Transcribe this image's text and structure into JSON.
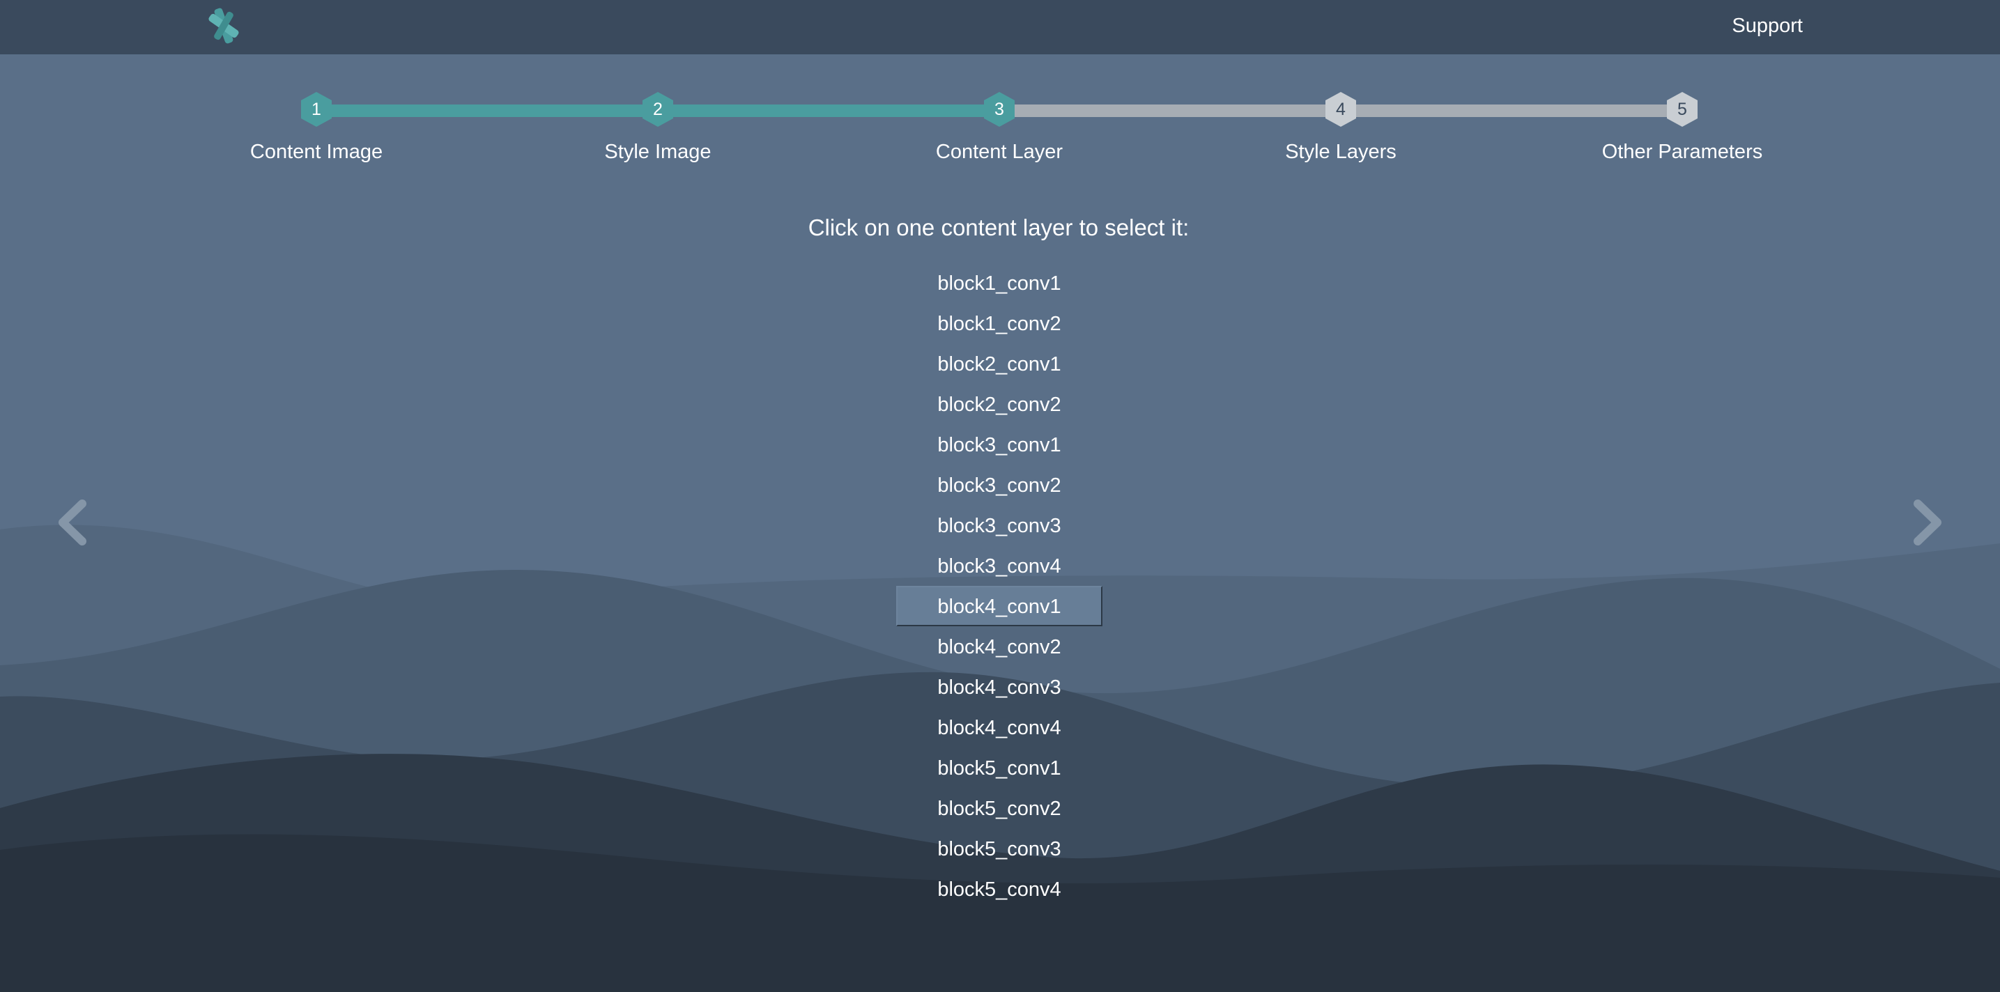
{
  "header": {
    "logo_icon": "scissors-x-logo-icon",
    "support_label": "Support"
  },
  "stepper": {
    "active_color": "#4a9d9f",
    "inactive_color": "#a7adb4",
    "current_step": 3,
    "steps": [
      {
        "number": "1",
        "label": "Content Image",
        "state": "complete"
      },
      {
        "number": "2",
        "label": "Style Image",
        "state": "complete"
      },
      {
        "number": "3",
        "label": "Content Layer",
        "state": "current"
      },
      {
        "number": "4",
        "label": "Style Layers",
        "state": "pending"
      },
      {
        "number": "5",
        "label": "Other Parameters",
        "state": "pending"
      }
    ]
  },
  "main": {
    "instruction": "Click on one content layer to select it:",
    "selected_layer": "block4_conv1",
    "layers": [
      "block1_conv1",
      "block1_conv2",
      "block2_conv1",
      "block2_conv2",
      "block3_conv1",
      "block3_conv2",
      "block3_conv3",
      "block3_conv4",
      "block4_conv1",
      "block4_conv2",
      "block4_conv3",
      "block4_conv4",
      "block5_conv1",
      "block5_conv2",
      "block5_conv3",
      "block5_conv4"
    ]
  },
  "navigation": {
    "prev_icon": "chevron-left-icon",
    "next_icon": "chevron-right-icon"
  }
}
